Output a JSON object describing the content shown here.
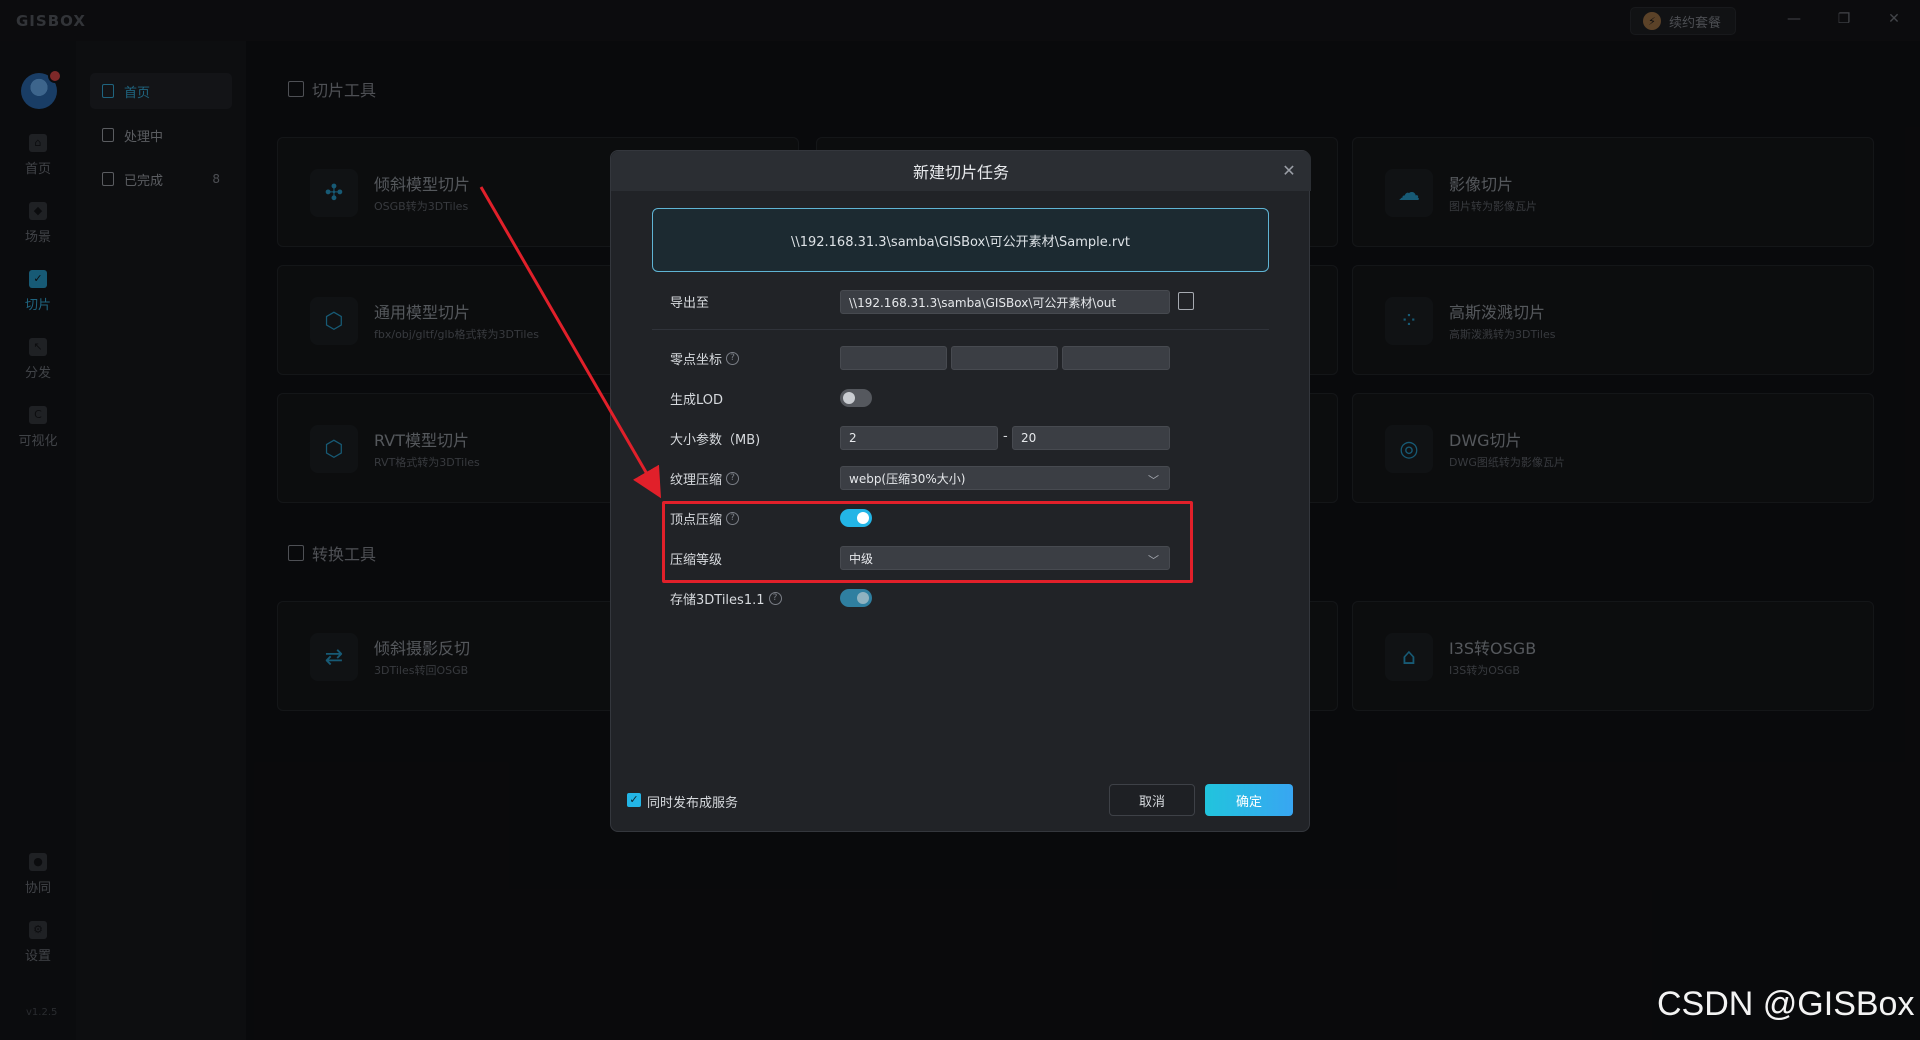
{
  "titlebar": {
    "logo": "GISBOX",
    "promo_label": "续约套餐",
    "minimize": "—",
    "restore": "❐",
    "close": "✕"
  },
  "rail": {
    "items": [
      {
        "label": "首页",
        "icon": "home-icon"
      },
      {
        "label": "场景",
        "icon": "cube-icon"
      },
      {
        "label": "切片",
        "icon": "slice-icon"
      },
      {
        "label": "分发",
        "icon": "distribute-icon"
      },
      {
        "label": "可视化",
        "icon": "visualize-icon"
      },
      {
        "label": "协同",
        "icon": "lock-icon"
      },
      {
        "label": "设置",
        "icon": "gear-icon"
      }
    ],
    "version": "v1.2.5"
  },
  "subnav": {
    "items": [
      {
        "label": "首页"
      },
      {
        "label": "处理中"
      },
      {
        "label": "已完成",
        "count": "8"
      }
    ]
  },
  "main": {
    "slice_tools_title": "切片工具",
    "convert_tools_title": "转换工具",
    "cards": [
      {
        "title": "倾斜模型切片",
        "sub": "OSGB转为3DTiles",
        "icon": "drone-icon"
      },
      {
        "title": "通用模型切片",
        "sub": "fbx/obj/gltf/glb格式转为3DTiles",
        "icon": "box-icon"
      },
      {
        "title": "RVT模型切片",
        "sub": "RVT格式转为3DTiles",
        "icon": "box-icon"
      },
      {
        "title": "影像切片",
        "sub": "图片转为影像瓦片",
        "icon": "cloud-play-icon"
      },
      {
        "title": "高斯泼溅切片",
        "sub": "高斯泼溅转为3DTiles",
        "icon": "dots-icon"
      },
      {
        "title": "DWG切片",
        "sub": "DWG图纸转为影像瓦片",
        "icon": "target-icon"
      },
      {
        "title": "倾斜摄影反切",
        "sub": "3DTiles转回OSGB",
        "icon": "swap-icon"
      },
      {
        "title": "I3S转OSGB",
        "sub": "I3S转为OSGB",
        "icon": "package-icon"
      }
    ]
  },
  "modal": {
    "title": "新建切片任务",
    "close": "✕",
    "source_path": "\\\\192.168.31.3\\samba\\GISBox\\可公开素材\\Sample.rvt",
    "export_label": "导出至",
    "export_path": "\\\\192.168.31.3\\samba\\GISBox\\可公开素材\\out",
    "origin_label": "零点坐标",
    "lod_label": "生成LOD",
    "size_label": "大小参数（MB)",
    "size_min": "2",
    "size_sep": "-",
    "size_max": "20",
    "texture_label": "纹理压缩",
    "texture_value": "webp(压缩30%大小)",
    "vertex_label": "顶点压缩",
    "level_label": "压缩等级",
    "level_value": "中级",
    "store_label": "存储3DTiles1.1",
    "toggles": {
      "lod": false,
      "vertex": true,
      "store": true
    },
    "publish_label": "同时发布成服务",
    "publish_checked": true,
    "cancel_label": "取消",
    "ok_label": "确定"
  },
  "watermark": "CSDN @GISBox",
  "colors": {
    "accent": "#23b5e6",
    "highlight": "#e1202a",
    "arrow": "#e1202a"
  }
}
